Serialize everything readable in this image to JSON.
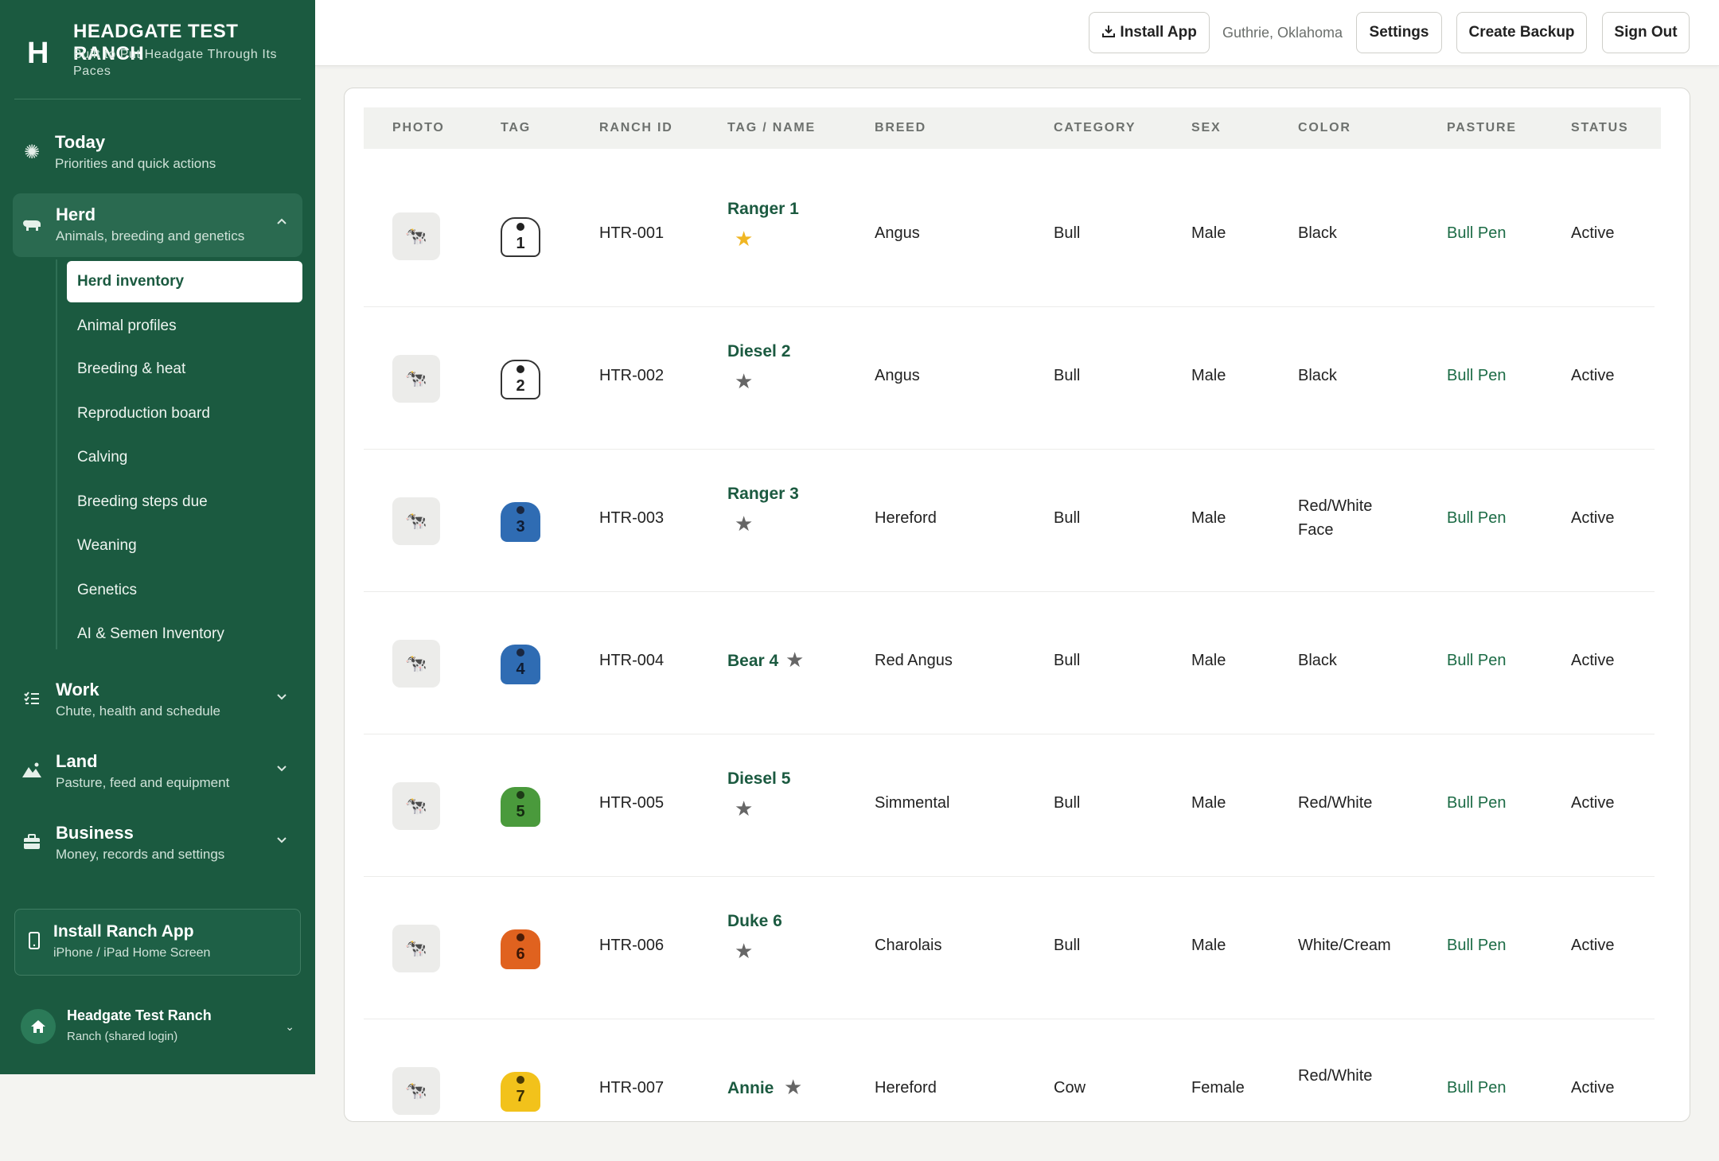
{
  "brand": {
    "logo": "H",
    "title": "HEADGATE TEST RANCH",
    "subtitle": "Built to Put Headgate Through Its Paces"
  },
  "nav": {
    "today": {
      "title": "Today",
      "sub": "Priorities and quick actions"
    },
    "herd": {
      "title": "Herd",
      "sub": "Animals, breeding and genetics"
    },
    "herd_items": [
      "Herd inventory",
      "Animal profiles",
      "Breeding & heat",
      "Reproduction board",
      "Calving",
      "Breeding steps due",
      "Weaning",
      "Genetics",
      "AI & Semen Inventory"
    ],
    "work": {
      "title": "Work",
      "sub": "Chute, health and schedule"
    },
    "land": {
      "title": "Land",
      "sub": "Pasture, feed and equipment"
    },
    "business": {
      "title": "Business",
      "sub": "Money, records and settings"
    }
  },
  "install_card": {
    "title": "Install Ranch App",
    "sub": "iPhone / iPad Home Screen"
  },
  "account": {
    "name": "Headgate Test Ranch",
    "role": "Ranch (shared login)"
  },
  "topbar": {
    "install_label": "Install App",
    "location": "Guthrie, Oklahoma",
    "settings_label": "Settings",
    "backup_label": "Create Backup",
    "signout_label": "Sign Out"
  },
  "table": {
    "headers": [
      "PHOTO",
      "TAG",
      "RANCH ID",
      "TAG / NAME",
      "BREED",
      "CATEGORY",
      "SEX",
      "COLOR",
      "PASTURE",
      "STATUS"
    ],
    "rows": [
      {
        "tag": "1",
        "id": "HTR-001",
        "name": "Ranger 1",
        "breed": "Angus",
        "category": "Bull",
        "sex": "Male",
        "color": "Black",
        "pasture": "Bull Pen",
        "status": "Active"
      },
      {
        "tag": "2",
        "id": "HTR-002",
        "name": "Diesel 2",
        "breed": "Angus",
        "category": "Bull",
        "sex": "Male",
        "color": "Black",
        "pasture": "Bull Pen",
        "status": "Active"
      },
      {
        "tag": "3",
        "id": "HTR-003",
        "name": "Ranger 3",
        "breed": "Hereford",
        "category": "Bull",
        "sex": "Male",
        "color": "Red/White Face",
        "pasture": "Bull Pen",
        "status": "Active"
      },
      {
        "tag": "4",
        "id": "HTR-004",
        "name": "Bear 4",
        "breed": "Red Angus",
        "category": "Bull",
        "sex": "Male",
        "color": "Black",
        "pasture": "Bull Pen",
        "status": "Active"
      },
      {
        "tag": "5",
        "id": "HTR-005",
        "name": "Diesel 5",
        "breed": "Simmental",
        "category": "Bull",
        "sex": "Male",
        "color": "Red/White",
        "pasture": "Bull Pen",
        "status": "Active"
      },
      {
        "tag": "6",
        "id": "HTR-006",
        "name": "Duke 6",
        "breed": "Charolais",
        "category": "Bull",
        "sex": "Male",
        "color": "White/Cream",
        "pasture": "Bull Pen",
        "status": "Active"
      },
      {
        "tag": "7",
        "id": "HTR-007",
        "name": "Annie",
        "breed": "Hereford",
        "category": "Cow",
        "sex": "Female",
        "color": "Red/White",
        "pasture": "Bull Pen",
        "status": "Active"
      }
    ]
  },
  "colors": {
    "sidebar": "#1b5a40",
    "accent": "#1b6b45",
    "star_favorite": "#f0b623",
    "tag_white": "#ffffff",
    "tag_blue": "#2f6cb3",
    "tag_green": "#4a9a3c",
    "tag_orange": "#e0621f",
    "tag_yellow": "#f2c21b"
  }
}
